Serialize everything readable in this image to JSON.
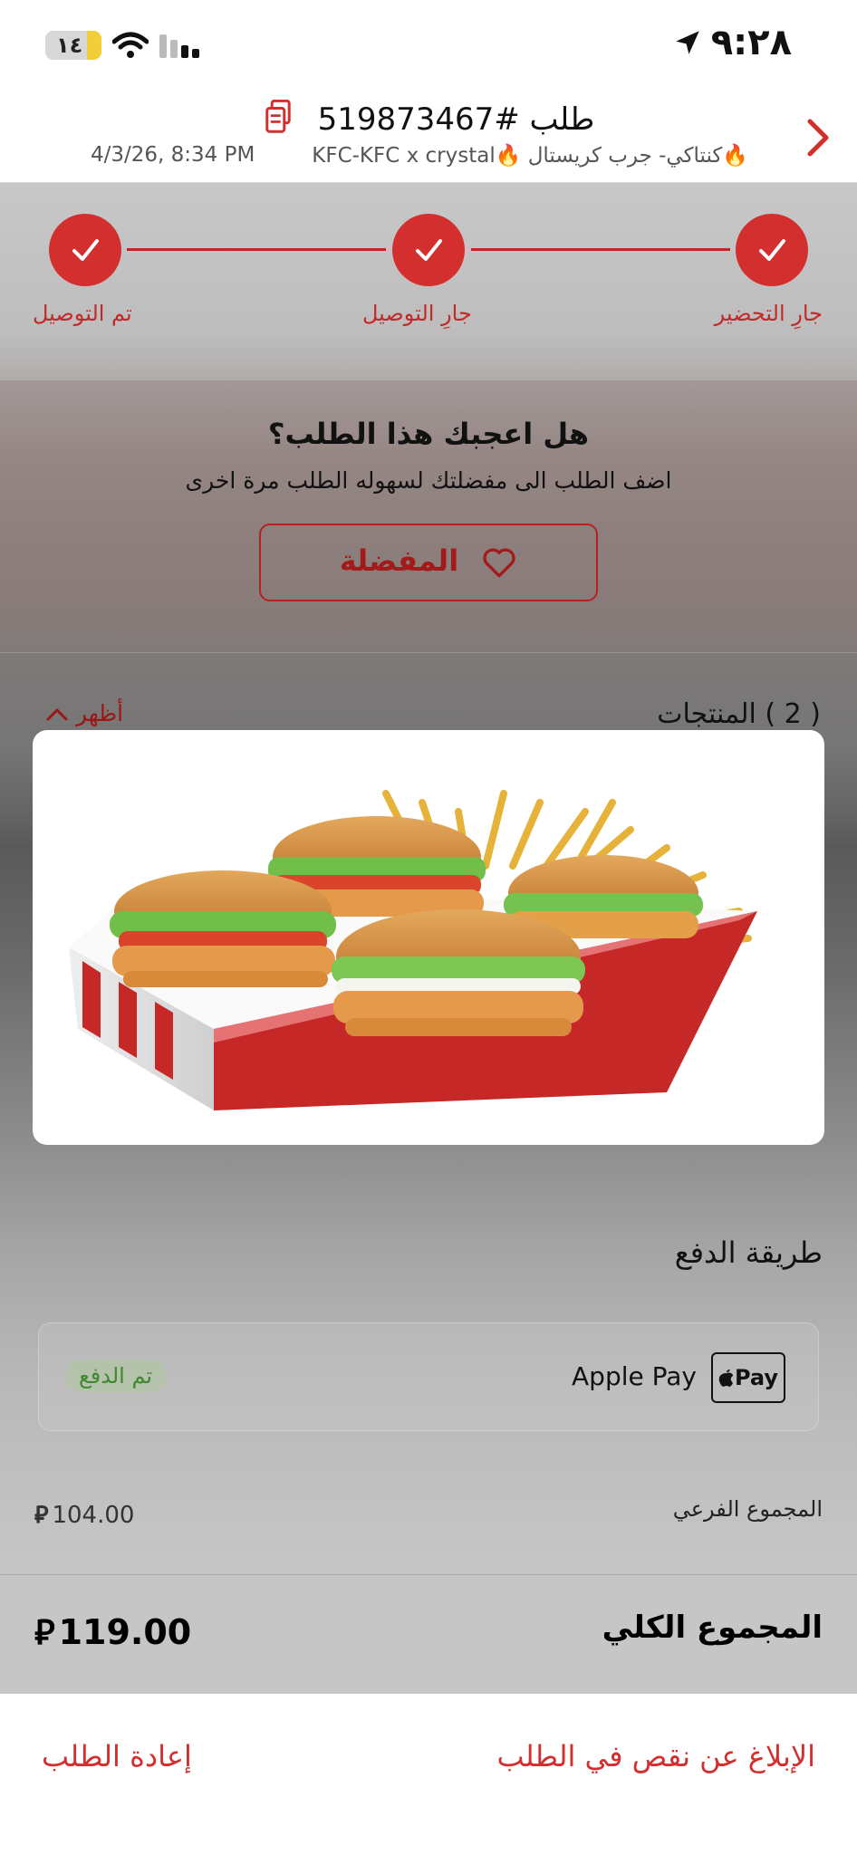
{
  "status_bar": {
    "time": "٩:٢٨",
    "battery": "١٤"
  },
  "header": {
    "title": "طلب #519873467",
    "store": "🔥كنتاكي- جرب كريستال 🔥KFC-KFC x crystal",
    "date": "4/3/26, 8:34 PM"
  },
  "stepper": {
    "steps": [
      {
        "label": "جارِ التحضير"
      },
      {
        "label": "جارِ التوصيل"
      },
      {
        "label": "تم التوصيل"
      }
    ],
    "accent": "#d32f2f"
  },
  "favorite": {
    "question": "هل اعجبك هذا الطلب؟",
    "subtitle": "اضف الطلب الى مفضلتك لسهوله الطلب مرة اخرى",
    "button_label": "المفضلة"
  },
  "products": {
    "title": "( 2 ) المنتجات",
    "toggle_label": "أظهر"
  },
  "payment": {
    "title": "طريقة الدفع",
    "method": "Apple Pay",
    "logo_text": "Pay",
    "status": "تم الدفع"
  },
  "summary": {
    "subtotal_label": "المجموع الفرعي",
    "subtotal_value": "104.00",
    "total_label": "المجموع الكلي",
    "total_value": "119.00"
  },
  "footer": {
    "report_label": "الإبلاغ عن نقص في الطلب",
    "reorder_label": "إعادة الطلب"
  }
}
